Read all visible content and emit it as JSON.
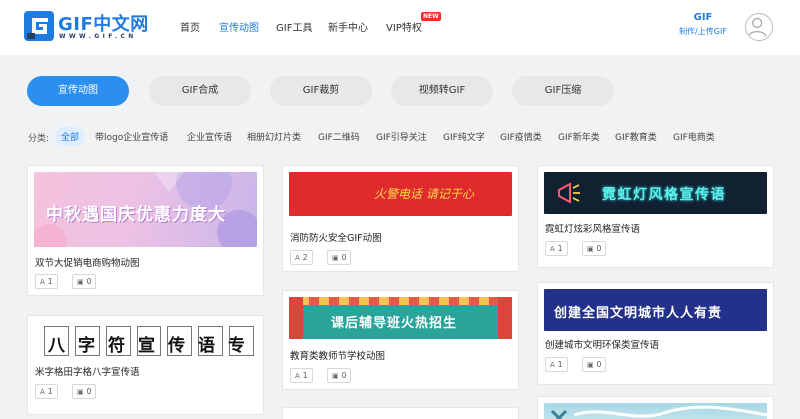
{
  "header": {
    "logo_text": "GIF中文网",
    "logo_sub": "WWW.GIF.CN",
    "nav": [
      "首页",
      "宣传动图",
      "GIF工具",
      "新手中心",
      "VIP特权"
    ],
    "nav_active": "宣传动图",
    "vip_badge": "NEW",
    "upload_title": "GIF",
    "upload_sub": "制作/上传GIF"
  },
  "tabs": [
    "宣传动图",
    "GIF合成",
    "GIF裁剪",
    "视频转GIF",
    "GIF压缩"
  ],
  "filters": {
    "label": "分类:",
    "items": [
      "全部",
      "带logo企业宣传语",
      "企业宣传语",
      "相册幻灯片类",
      "GIF二维码",
      "GIF引导关注",
      "GIF纯文字",
      "GIF疫情类",
      "GIF新年类",
      "GIF教育类",
      "GIF电商类"
    ]
  },
  "cards": [
    {
      "title": "双节大促销电商购物动图",
      "thumb_text": "中秋遇国庆优惠力度大",
      "likes": "1",
      "images": "0"
    },
    {
      "title": "米字格田字格八字宣传语",
      "thumb_text": "八字符宣传语专用",
      "likes": "1",
      "images": "0"
    },
    {
      "title": "消防防火安全GIF动图",
      "thumb_text": "火警电话 请记于心",
      "likes": "2",
      "images": "0"
    },
    {
      "title": "教育类教师节学校动图",
      "thumb_text": "课后辅导班火热招生",
      "likes": "1",
      "images": "0"
    },
    {
      "title": "霓虹灯炫彩风格宣传语",
      "thumb_text": "霓虹灯风格宣传语",
      "likes": "1",
      "images": "0"
    },
    {
      "title": "创建城市文明环保类宣传语",
      "thumb_text": "创建全国文明城市人人有责",
      "likes": "1",
      "images": "0"
    }
  ],
  "colors": {
    "accent": "#1e7be0",
    "tab_active": "#2b8ff0",
    "badge": "#e8312b"
  }
}
